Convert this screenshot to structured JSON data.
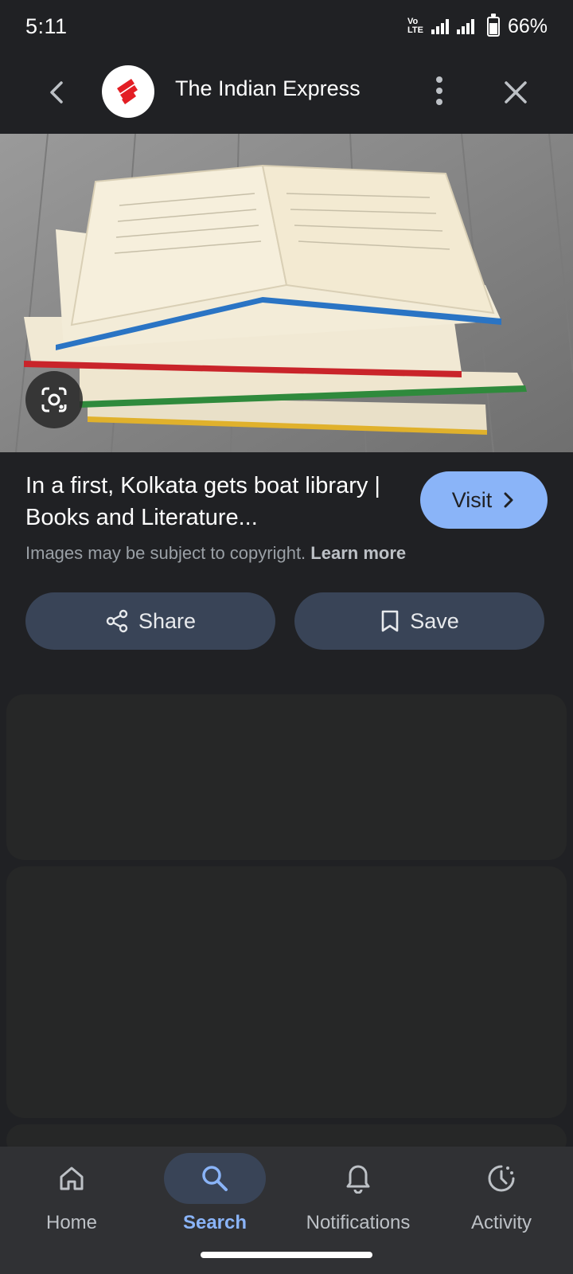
{
  "status_bar": {
    "time": "5:11",
    "network": "VoLTE 4G",
    "battery": "66%",
    "battery_level": 0.66
  },
  "header": {
    "source_name": "The Indian Express",
    "logo_color": "#e31e24"
  },
  "result": {
    "title": "In a first, Kolkata gets boat library | Books and Literature...",
    "visit_label": "Visit",
    "copyright_text": "Images may be subject to copyright.",
    "learn_more": "Learn more",
    "share_label": "Share",
    "save_label": "Save"
  },
  "bottom_nav": {
    "items": [
      {
        "label": "Home",
        "icon": "home-icon"
      },
      {
        "label": "Search",
        "icon": "search-icon",
        "active": true
      },
      {
        "label": "Notifications",
        "icon": "bell-icon"
      },
      {
        "label": "Activity",
        "icon": "activity-icon"
      }
    ]
  },
  "colors": {
    "background": "#202124",
    "accent": "#8ab4f8",
    "chip": "#394457",
    "nav_bg": "#303134"
  }
}
